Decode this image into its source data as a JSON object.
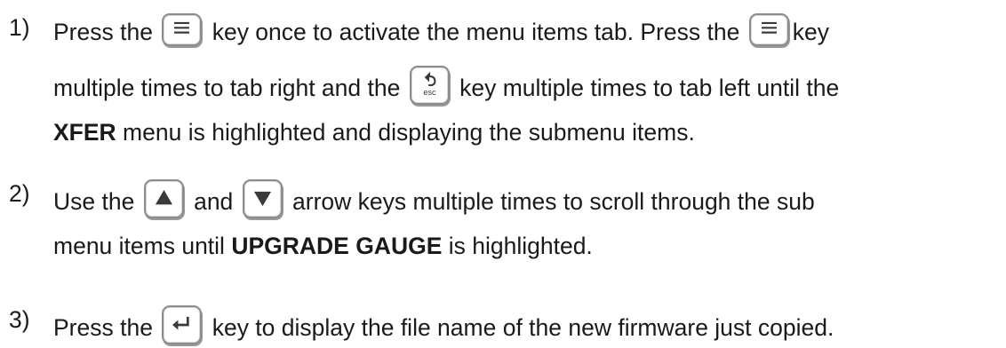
{
  "steps": [
    {
      "number": "1)",
      "l1a": "Press the",
      "l1b": "key once to activate the menu items tab.  Press the",
      "l1c": "key",
      "l2a": "multiple times to tab right and the",
      "l2b": "key multiple times to tab left until the",
      "l3_bold": "XFER",
      "l3_rest": " menu is highlighted and displaying the submenu items."
    },
    {
      "number": "2)",
      "l1a": "Use the",
      "l1b": "and",
      "l1c": "arrow keys multiple times to scroll through the sub",
      "l2a": "menu items until ",
      "l2_bold": "UPGRADE GAUGE",
      "l2b": " is highlighted."
    },
    {
      "number": "3)",
      "l1a": "Press the",
      "l1b": "key to display the file name of the new firmware just copied."
    }
  ],
  "keys": {
    "esc_label": "esc"
  }
}
